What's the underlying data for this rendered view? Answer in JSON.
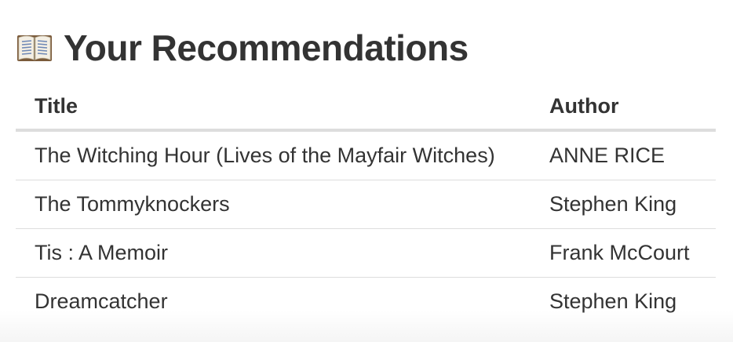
{
  "header": {
    "icon": "open-book-icon",
    "title": "Your Recommendations"
  },
  "table": {
    "columns": [
      "Title",
      "Author"
    ],
    "rows": [
      {
        "title": "The Witching Hour (Lives of the Mayfair Witches)",
        "author": "ANNE RICE"
      },
      {
        "title": "The Tommyknockers",
        "author": "Stephen King"
      },
      {
        "title": "Tis : A Memoir",
        "author": "Frank McCourt"
      },
      {
        "title": "Dreamcatcher",
        "author": "Stephen King"
      }
    ]
  }
}
